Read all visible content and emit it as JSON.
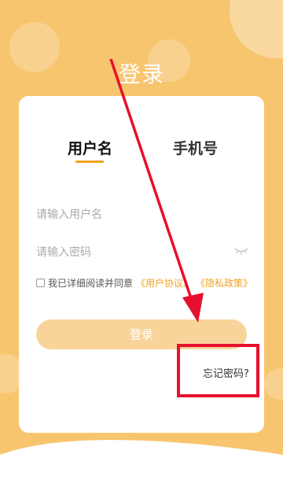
{
  "header": {
    "title": "登录"
  },
  "tabs": [
    {
      "label": "用户名",
      "active": true
    },
    {
      "label": "手机号",
      "active": false
    }
  ],
  "form": {
    "username_placeholder": "请输入用户名",
    "password_placeholder": "请输入密码",
    "agreement_prefix": "我已详细阅读并同意",
    "user_agreement": "《用户协议》",
    "privacy_policy": "《隐私政策》",
    "login_label": "登录",
    "forgot_label": "忘记密码?"
  },
  "colors": {
    "background": "#F8C56F",
    "accent": "#F0A21E",
    "login_button": "#F9D49A",
    "annotation": "#E6102E"
  },
  "icons": {
    "password_toggle": "eye-closed-icon"
  }
}
